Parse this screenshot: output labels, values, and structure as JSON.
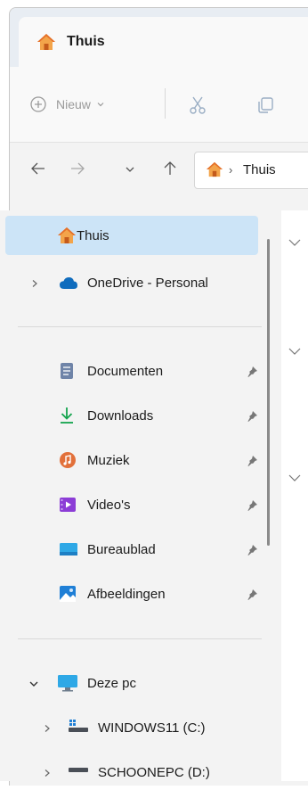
{
  "tab": {
    "label": "Thuis",
    "icon": "home-icon"
  },
  "toolbar": {
    "new_label": "Nieuw"
  },
  "address": {
    "label": "Thuis",
    "separator": "›"
  },
  "sidebar": {
    "home": {
      "label": "Thuis"
    },
    "onedrive": {
      "label": "OneDrive - Personal"
    },
    "quick_access": [
      {
        "label": "Documenten",
        "icon": "document-icon"
      },
      {
        "label": "Downloads",
        "icon": "download-icon"
      },
      {
        "label": "Muziek",
        "icon": "music-icon"
      },
      {
        "label": "Video's",
        "icon": "video-icon"
      },
      {
        "label": "Bureaublad",
        "icon": "desktop-icon"
      },
      {
        "label": "Afbeeldingen",
        "icon": "pictures-icon"
      }
    ],
    "this_pc": {
      "label": "Deze pc"
    },
    "drives": [
      {
        "label": "WINDOWS11 (C:)"
      },
      {
        "label": "SCHOONEPC (D:)"
      }
    ]
  },
  "colors": {
    "selected": "#cce4f7",
    "accent": "#0a74da",
    "home": "#e8762c"
  }
}
